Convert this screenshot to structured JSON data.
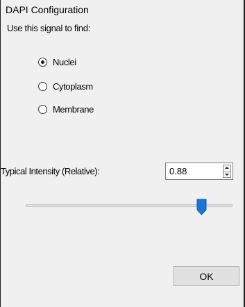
{
  "dialog": {
    "title": "DAPI Configuration",
    "prompt": "Use this signal to find:",
    "options": [
      {
        "label": "Nuclei",
        "selected": true
      },
      {
        "label": "Cytoplasm",
        "selected": false
      },
      {
        "label": "Membrane",
        "selected": false
      }
    ],
    "intensity": {
      "label": "Typical Intensity (Relative):",
      "value": "0.88",
      "slider_fraction": 0.85
    },
    "ok_label": "OK"
  },
  "colors": {
    "background": "#f0f0f0",
    "slider_thumb": "#1c74d4",
    "button_face": "#e1e1e1"
  }
}
